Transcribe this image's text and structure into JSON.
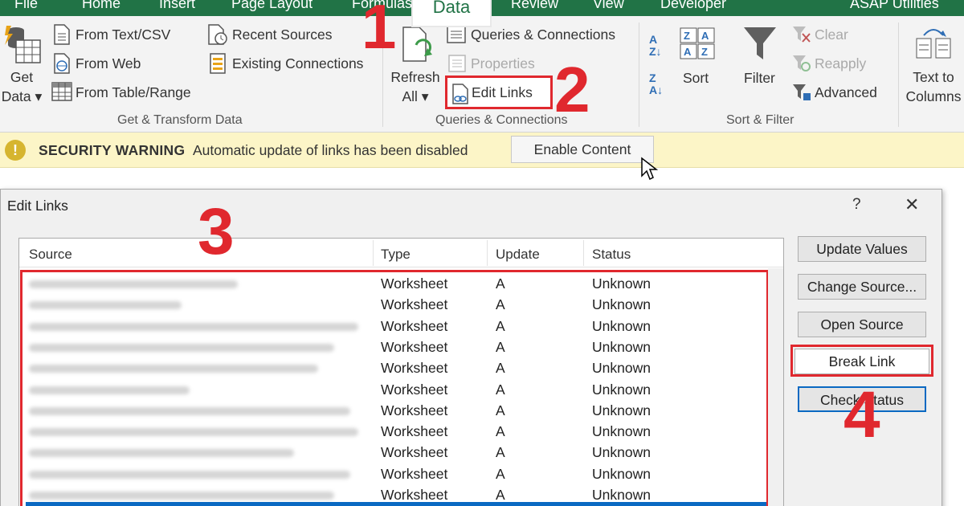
{
  "tabs": [
    "File",
    "Home",
    "Insert",
    "Page Layout",
    "Formulas",
    "Data",
    "Review",
    "View",
    "Developer",
    "ASAP Utilities"
  ],
  "active_tab": "Data",
  "ribbon": {
    "get_data": {
      "line1": "Get",
      "line2": "Data ▾"
    },
    "get_transform": [
      "From Text/CSV",
      "From Web",
      "From Table/Range",
      "Recent Sources",
      "Existing Connections"
    ],
    "get_transform_label": "Get & Transform Data",
    "refresh": {
      "line1": "Refresh",
      "line2": "All ▾"
    },
    "queries": {
      "connections": "Queries & Connections",
      "properties": "Properties",
      "edit_links": "Edit Links"
    },
    "queries_label": "Queries & Connections",
    "sort": "Sort",
    "filter": "Filter",
    "filter_opts": [
      "Clear",
      "Reapply",
      "Advanced"
    ],
    "sort_filter_label": "Sort & Filter",
    "text_to_columns": {
      "line1": "Text to",
      "line2": "Columns"
    }
  },
  "security_bar": {
    "title": "SECURITY WARNING",
    "message": "Automatic update of links has been disabled",
    "button": "Enable Content"
  },
  "dialog": {
    "title": "Edit Links",
    "help": "?",
    "close": "✕",
    "columns": [
      "Source",
      "Type",
      "Update",
      "Status"
    ],
    "rows": [
      {
        "type": "Worksheet",
        "update": "A",
        "status": "Unknown"
      },
      {
        "type": "Worksheet",
        "update": "A",
        "status": "Unknown"
      },
      {
        "type": "Worksheet",
        "update": "A",
        "status": "Unknown"
      },
      {
        "type": "Worksheet",
        "update": "A",
        "status": "Unknown"
      },
      {
        "type": "Worksheet",
        "update": "A",
        "status": "Unknown"
      },
      {
        "type": "Worksheet",
        "update": "A",
        "status": "Unknown"
      },
      {
        "type": "Worksheet",
        "update": "A",
        "status": "Unknown"
      },
      {
        "type": "Worksheet",
        "update": "A",
        "status": "Unknown"
      },
      {
        "type": "Worksheet",
        "update": "A",
        "status": "Unknown"
      },
      {
        "type": "Worksheet",
        "update": "A",
        "status": "Unknown"
      },
      {
        "type": "Worksheet",
        "update": "A",
        "status": "Unknown"
      }
    ],
    "buttons": {
      "update_values": "Update Values",
      "change_source": "Change Source...",
      "open_source": "Open Source",
      "break_link": "Break Link",
      "check_status": "Check Status"
    }
  },
  "steps": [
    "1",
    "2",
    "3",
    "4"
  ],
  "colors": {
    "excel_green": "#217346",
    "highlight_red": "#e0282e",
    "selection_blue": "#0a69c2",
    "warning_bar": "#fcf5c7"
  }
}
